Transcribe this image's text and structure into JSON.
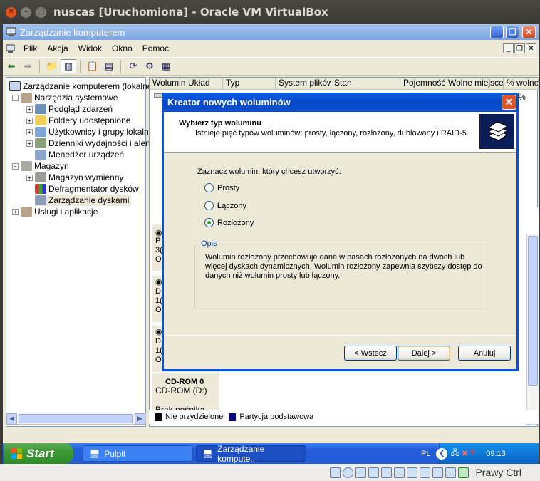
{
  "vbox": {
    "title": "nuscas [Uruchomiona] - Oracle VM VirtualBox",
    "host_key": "Prawy Ctrl"
  },
  "window": {
    "title": "Zarządzanie komputerem"
  },
  "menu": [
    "Plik",
    "Akcja",
    "Widok",
    "Okno",
    "Pomoc"
  ],
  "tree": {
    "root": "Zarządzanie komputerem (lokalne)",
    "items": [
      {
        "label": "Narzędzia systemowe"
      },
      {
        "label": "Podgląd zdarzeń"
      },
      {
        "label": "Foldery udostępnione"
      },
      {
        "label": "Użytkownicy i grupy lokalne"
      },
      {
        "label": "Dzienniki wydajności i alerty"
      },
      {
        "label": "Menedżer urządzeń"
      },
      {
        "label": "Magazyn"
      },
      {
        "label": "Magazyn wymienny"
      },
      {
        "label": "Defragmentator dysków"
      },
      {
        "label": "Zarządzanie dyskami"
      },
      {
        "label": "Usługi i aplikacje"
      }
    ]
  },
  "columns": [
    "Wolumin",
    "Układ",
    "Typ",
    "System plików",
    "Stan",
    "Pojemność",
    "Wolne miejsce",
    "% wolneg"
  ],
  "column_fragment": "%",
  "disk_labels": {
    "d0": [
      "P",
      "3(",
      "O"
    ],
    "d1": [
      "D",
      "1(",
      "O"
    ],
    "d2": [
      "D",
      "1(",
      "O"
    ],
    "cd_header": "CD-ROM 0",
    "cd": "CD-ROM (D:)",
    "cd_status": "Brak nośnika"
  },
  "legend": {
    "unallocated": "Nie przydzielone",
    "primary": "Partycja podstawowa"
  },
  "taskbar": {
    "start": "Start",
    "tasks": [
      "Pulpit",
      "Zarządzanie kompute..."
    ],
    "lang": "PL",
    "clock": "09:13"
  },
  "dialog": {
    "title": "Kreator nowych woluminów",
    "heading": "Wybierz typ woluminu",
    "subheading": "Istnieje pięć typów woluminów: prosty, łączony, rozłożony, dublowany i RAID-5.",
    "prompt": "Zaznacz wolumin, który chcesz utworzyć:",
    "options": [
      "Prosty",
      "Łączony",
      "Rozłożony"
    ],
    "selected": "Rozłożony",
    "opis_label": "Opis",
    "opis_text": "Wolumin rozłożony przechowuje dane w pasach rozłożonych na dwóch lub więcej dyskach dynamicznych. Wolumin rozłożony zapewnia szybszy dostęp do danych niż wolumin prosty lub łączony.",
    "back": "< Wstecz",
    "next": "Dalej >",
    "cancel": "Anuluj"
  },
  "colors": {
    "xp_blue": "#0054e3",
    "start_green": "#3c9a35",
    "dialog_bg": "#ece9d8"
  }
}
